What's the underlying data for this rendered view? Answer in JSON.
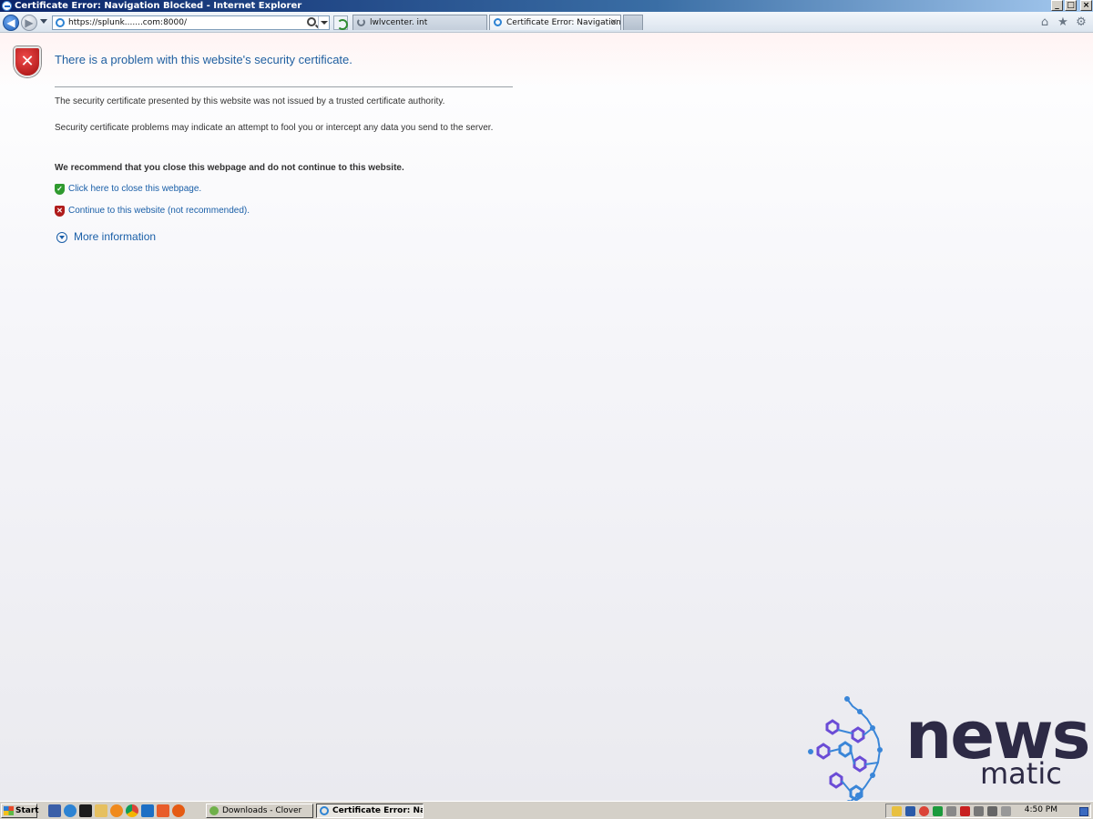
{
  "window": {
    "title": "Certificate Error: Navigation Blocked - Internet Explorer",
    "minimize_glyph": "_",
    "maximize_glyph": "□",
    "close_glyph": "×"
  },
  "nav": {
    "back_glyph": "◀",
    "forward_glyph": "▶",
    "url": "https://splunk.......com:8000/",
    "tabs": [
      {
        "label": "lwlvcenter.        int",
        "state": "loading"
      },
      {
        "label": "Certificate Error: Navigation ...",
        "state": "active",
        "close_glyph": "×"
      }
    ],
    "toolbar_icons": [
      {
        "name": "home-icon",
        "glyph": "⌂"
      },
      {
        "name": "favorites-icon",
        "glyph": "★"
      },
      {
        "name": "tools-icon",
        "glyph": "⚙"
      }
    ]
  },
  "page": {
    "shield_glyph": "✕",
    "heading": "There is a problem with this website's security certificate.",
    "para1": "The security certificate presented by this website was not issued by a trusted certificate authority.",
    "para2": "Security certificate problems may indicate an attempt to fool you or intercept any data you send to the server.",
    "recommendation": "We recommend that you close this webpage and do not continue to this website.",
    "close_link": "Click here to close this webpage.",
    "close_glyph": "✓",
    "continue_link": "Continue to this website (not recommended).",
    "continue_glyph": "✕",
    "more_info": "More information"
  },
  "watermark": {
    "line1": "news",
    "line2": "matic"
  },
  "taskbar": {
    "start_label": "Start",
    "buttons": [
      {
        "label": "Downloads - Clover",
        "active": false
      },
      {
        "label": "Certificate Error: Navi...",
        "active": true
      }
    ],
    "clock": "4:50 PM"
  },
  "colors": {
    "link": "#1a5fa8",
    "heading": "#1f5fa0",
    "shield": "#b01c1c",
    "logo_text": "#2d2a45",
    "logo_accent_blue": "#3a86d8",
    "logo_accent_purple": "#6b4cd6"
  }
}
